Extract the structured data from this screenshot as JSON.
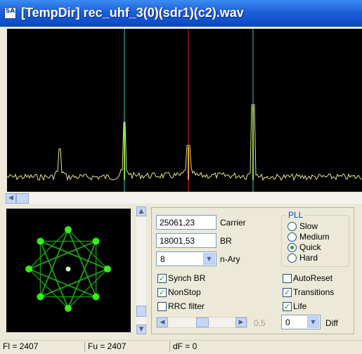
{
  "window": {
    "title": "[TempDir] rec_uhf_3(0)(sdr1)(c2).wav",
    "icon_text": "SA"
  },
  "colors": {
    "spectrum_trace": "#e8e48a",
    "marker_cyan": "#36c8c8",
    "marker_red": "#e02020",
    "constellation": "#3cff1e",
    "title_blue": "#0a46c8"
  },
  "fields": {
    "carrier": {
      "value": "25061,23",
      "label": "Carrier"
    },
    "br": {
      "value": "18001,53",
      "label": "BR"
    },
    "n_ary": {
      "value": "8",
      "label": "n-Ary"
    }
  },
  "pll": {
    "title": "PLL",
    "options": [
      {
        "label": "Slow",
        "selected": false
      },
      {
        "label": "Medium",
        "selected": false
      },
      {
        "label": "Quick",
        "selected": true
      },
      {
        "label": "Hard",
        "selected": false
      }
    ]
  },
  "checks": {
    "synch_br": {
      "label": "Synch BR",
      "checked": true
    },
    "nonstop": {
      "label": "NonStop",
      "checked": true
    },
    "rrc_filter": {
      "label": "RRC filter",
      "checked": false
    },
    "autoreset": {
      "label": "AutoReset",
      "checked": false
    },
    "transitions": {
      "label": "Transitions",
      "checked": true
    },
    "life": {
      "label": "Life",
      "checked": true
    }
  },
  "rolloff": {
    "value_label": "0,5"
  },
  "diff": {
    "value": "0",
    "label": "Diff"
  },
  "status": {
    "fl": "Fl = 2407",
    "fu": "Fu = 2407",
    "df": "dF = 0"
  }
}
